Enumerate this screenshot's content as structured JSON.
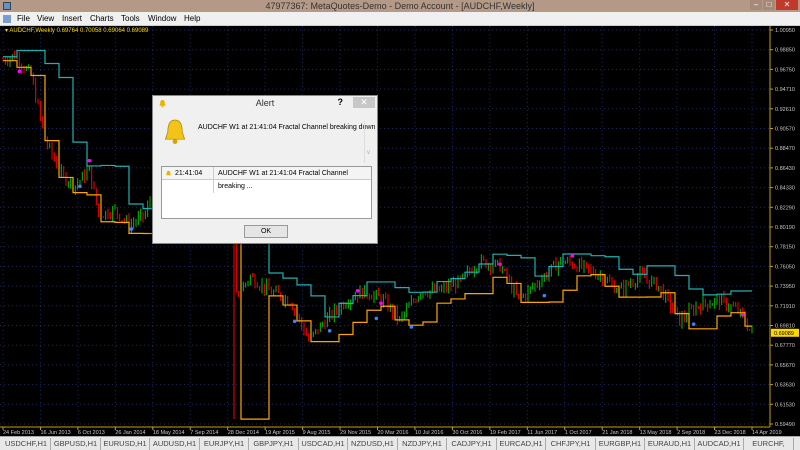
{
  "window": {
    "title": "47977367: MetaQuotes-Demo - Demo Account - [AUDCHF,Weekly]"
  },
  "menu": [
    "File",
    "View",
    "Insert",
    "Charts",
    "Tools",
    "Window",
    "Help"
  ],
  "chart_header": {
    "symbol": "AUDCHF,Weekly",
    "ohlc": "0.69764 0.70058 0.69064 0.69089"
  },
  "alert": {
    "title": "Alert",
    "help": "?",
    "close": "✕",
    "message": "AUDCHF W1 at 21:41:04 Fractal Channel breaking down",
    "list": [
      {
        "time": "21:41:04",
        "text": "AUDCHF W1 at 21:41:04 Fractal Channel breaking ..."
      }
    ],
    "ok": "OK"
  },
  "tabs": [
    "USDCHF,H1",
    "GBPUSD,H1",
    "EURUSD,H1",
    "AUDUSD,H1",
    "EURJPY,H1",
    "GBPJPY,H1",
    "USDCAD,H1",
    "NZDUSD,H1",
    "NZDJPY,H1",
    "CADJPY,H1",
    "EURCAD,H1",
    "CHFJPY,H1",
    "EURGBP,H1",
    "EURAUD,H1",
    "AUDCAD,H1",
    "EURCHF,"
  ],
  "colors": {
    "bull": "#00c000",
    "bear": "#ff0000",
    "upper": "#20b0b0",
    "lower": "#ffa500",
    "axis": "#c8a000",
    "fractal_up": "#ff00ff",
    "fractal_down": "#4080ff"
  },
  "chart_data": {
    "type": "candlestick",
    "symbol": "AUDCHF",
    "timeframe": "Weekly",
    "ylim": [
      0.5949,
      1.0095
    ],
    "y_ticks": [
      "1.00950",
      "0.98850",
      "0.96750",
      "0.94710",
      "0.92610",
      "0.90570",
      "0.88470",
      "0.86430",
      "0.84330",
      "0.82290",
      "0.80190",
      "0.78150",
      "0.76050",
      "0.73950",
      "0.71910",
      "0.69810",
      "0.67770",
      "0.65670",
      "0.63630",
      "0.61530",
      "0.59490"
    ],
    "current_price": "0.69089",
    "x_ticks": [
      "24 Feb 2013",
      "16 Jun 2013",
      "6 Oct 2013",
      "26 Jan 2014",
      "18 May 2014",
      "7 Sep 2014",
      "28 Dec 2014",
      "19 Apr 2015",
      "9 Aug 2015",
      "29 Nov 2015",
      "20 Mar 2016",
      "10 Jul 2016",
      "30 Oct 2016",
      "19 Feb 2017",
      "11 Jun 2017",
      "1 Oct 2017",
      "21 Jan 2018",
      "13 May 2018",
      "2 Sep 2018",
      "23 Dec 2018",
      "14 Apr 2019"
    ],
    "weeks": 321,
    "price_keyframes": [
      [
        0,
        0.978
      ],
      [
        5,
        0.983
      ],
      [
        12,
        0.962
      ],
      [
        18,
        0.894
      ],
      [
        25,
        0.857
      ],
      [
        31,
        0.846
      ],
      [
        37,
        0.862
      ],
      [
        41,
        0.815
      ],
      [
        48,
        0.82
      ],
      [
        54,
        0.804
      ],
      [
        61,
        0.815
      ],
      [
        63,
        0.83
      ],
      [
        75,
        0.84
      ],
      [
        88,
        0.83
      ],
      [
        99,
        0.79
      ],
      [
        100,
        0.73
      ],
      [
        106,
        0.75
      ],
      [
        114,
        0.735
      ],
      [
        123,
        0.725
      ],
      [
        131,
        0.683
      ],
      [
        138,
        0.703
      ],
      [
        147,
        0.725
      ],
      [
        155,
        0.735
      ],
      [
        163,
        0.725
      ],
      [
        170,
        0.704
      ],
      [
        179,
        0.735
      ],
      [
        187,
        0.735
      ],
      [
        196,
        0.745
      ],
      [
        204,
        0.766
      ],
      [
        213,
        0.761
      ],
      [
        221,
        0.725
      ],
      [
        230,
        0.746
      ],
      [
        239,
        0.767
      ],
      [
        247,
        0.761
      ],
      [
        256,
        0.751
      ],
      [
        264,
        0.735
      ],
      [
        273,
        0.751
      ],
      [
        281,
        0.74
      ],
      [
        290,
        0.704
      ],
      [
        298,
        0.72
      ],
      [
        307,
        0.725
      ],
      [
        315,
        0.714
      ],
      [
        321,
        0.691
      ]
    ],
    "spike": {
      "week": 99,
      "low": 0.6
    },
    "fractals": [
      [
        7,
        0.966,
        "up"
      ],
      [
        37,
        0.872,
        "up"
      ],
      [
        33,
        0.845,
        "down"
      ],
      [
        55,
        0.8,
        "down"
      ],
      [
        152,
        0.735,
        "up"
      ],
      [
        162,
        0.722,
        "up"
      ],
      [
        160,
        0.706,
        "down"
      ],
      [
        175,
        0.697,
        "down"
      ],
      [
        213,
        0.763,
        "up"
      ],
      [
        232,
        0.73,
        "down"
      ],
      [
        244,
        0.772,
        "up"
      ],
      [
        296,
        0.7,
        "down"
      ],
      [
        317,
        0.71,
        "up"
      ],
      [
        125,
        0.703,
        "down"
      ],
      [
        140,
        0.693,
        "down"
      ]
    ]
  }
}
